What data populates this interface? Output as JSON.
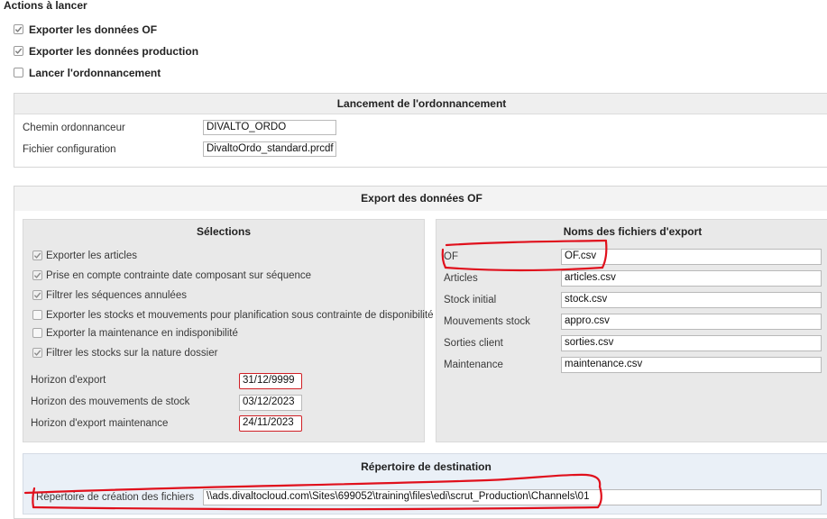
{
  "title": "Actions à lancer",
  "actions": [
    {
      "label": "Exporter les données OF",
      "checked": true
    },
    {
      "label": "Exporter les données production",
      "checked": true
    },
    {
      "label": "Lancer l'ordonnancement",
      "checked": false
    }
  ],
  "lancement": {
    "header": "Lancement de l'ordonnancement",
    "rows": [
      {
        "label": "Chemin ordonnanceur",
        "value": "DIVALTO_ORDO"
      },
      {
        "label": "Fichier configuration",
        "value": "DivaltoOrdo_standard.prcdf"
      }
    ]
  },
  "export_of": {
    "header": "Export des données OF",
    "selections": {
      "header": "Sélections",
      "checks": [
        {
          "label": "Exporter les articles",
          "checked": true
        },
        {
          "label": "Prise en compte contrainte date composant sur séquence",
          "checked": true
        },
        {
          "label": "Filtrer les séquences annulées",
          "checked": true
        },
        {
          "label": "Exporter les stocks et mouvements pour planification sous contrainte de disponibilité",
          "checked": false
        },
        {
          "label": "Exporter la maintenance en indisponibilité",
          "checked": false
        },
        {
          "label": "Filtrer les stocks sur la nature dossier",
          "checked": true
        }
      ],
      "horizons": [
        {
          "label": "Horizon d'export",
          "value": "31/12/9999",
          "highlighted": true
        },
        {
          "label": "Horizon des mouvements de stock",
          "value": "03/12/2023",
          "highlighted": false
        },
        {
          "label": "Horizon d'export maintenance",
          "value": "24/11/2023",
          "highlighted": true
        }
      ]
    },
    "files": {
      "header": "Noms des fichiers d'export",
      "rows": [
        {
          "label": "OF",
          "value": "OF.csv"
        },
        {
          "label": "Articles",
          "value": "articles.csv"
        },
        {
          "label": "Stock initial",
          "value": "stock.csv"
        },
        {
          "label": "Mouvements stock",
          "value": "appro.csv"
        },
        {
          "label": "Sorties client",
          "value": "sorties.csv"
        },
        {
          "label": "Maintenance",
          "value": "maintenance.csv"
        }
      ]
    },
    "destination": {
      "header": "Répertoire de destination",
      "label": "Répertoire de création des fichiers",
      "value": "\\\\ads.divaltocloud.com\\Sites\\699052\\training\\files\\edi\\scrut_Production\\Channels\\01"
    }
  },
  "colors": {
    "annotation": "#e0101c",
    "check": "#7a7a7a",
    "input_error_border": "#d01f25"
  }
}
